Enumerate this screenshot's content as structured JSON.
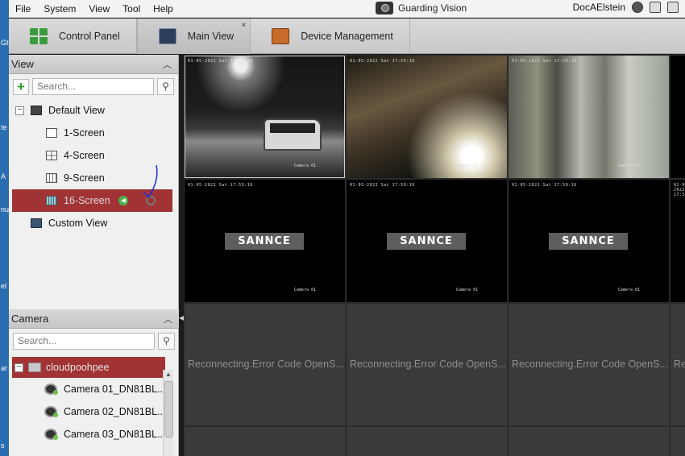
{
  "desktop_sliver": [
    "Gt",
    "te",
    "A",
    "nu",
    "el",
    "ar",
    "s"
  ],
  "menubar": {
    "items": [
      "File",
      "System",
      "View",
      "Tool",
      "Help"
    ],
    "app_title": "Guarding Vision",
    "user": "DocAElstein"
  },
  "tabs": [
    {
      "label": "Control Panel",
      "icon": "control-panel-icon",
      "active": false
    },
    {
      "label": "Main View",
      "icon": "main-view-icon",
      "active": true,
      "close": "×"
    },
    {
      "label": "Device Management",
      "icon": "device-management-icon",
      "active": false
    }
  ],
  "view_panel": {
    "title": "View",
    "search_placeholder": "Search...",
    "root": "Default View",
    "items": [
      "1-Screen",
      "4-Screen",
      "9-Screen",
      "16-Screen"
    ],
    "selected": "16-Screen",
    "custom": "Custom View"
  },
  "camera_panel": {
    "title": "Camera",
    "search_placeholder": "Search...",
    "group": "cloudpoohpee",
    "cameras": [
      "Camera 01_DN81BL...",
      "Camera 02_DN81BL...",
      "Camera 03_DN81BL..."
    ]
  },
  "grid": {
    "logo_text": "SANNCE",
    "timestamp": "01-05-2022 Sat 17:59:16",
    "cam_label": "Camera 01",
    "error_text": "Reconnecting.Error Code OpenS...",
    "error_short": "Re"
  },
  "colors": {
    "selection": "#a23335",
    "accent_green": "#49b24a"
  }
}
